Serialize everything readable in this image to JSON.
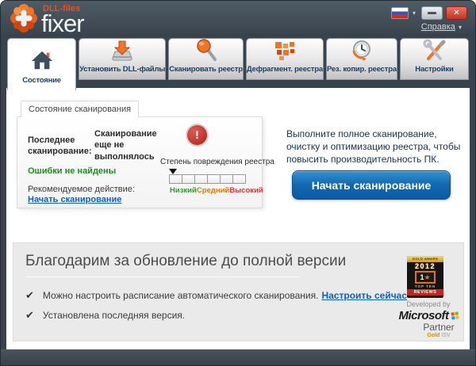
{
  "window": {
    "help_label": "Справка",
    "logo": {
      "brand_top": "DLL-files",
      "brand_main": "fixer"
    }
  },
  "icons": {
    "check": "✔",
    "caret_down": "▾",
    "close": "✕",
    "warning": "!",
    "star": "★"
  },
  "tabs": [
    {
      "label": "Состояние",
      "icon": "home-icon",
      "active": true
    },
    {
      "label": "Установить DLL-файлы",
      "icon": "install-dll-icon",
      "active": false
    },
    {
      "label": "Сканировать реестр",
      "icon": "scan-registry-icon",
      "active": false
    },
    {
      "label": "Дефрагмент. реестра",
      "icon": "defrag-registry-icon",
      "active": false
    },
    {
      "label": "Рез. копир. реестра",
      "icon": "backup-registry-icon",
      "active": false
    },
    {
      "label": "Настройки",
      "icon": "settings-icon",
      "active": false
    }
  ],
  "scan_status": {
    "tab_label": "Состояние сканирования",
    "last_scan_label": "Последнее сканирование:",
    "last_scan_value": "Сканирование еще не выполнялось",
    "errors_text": "Ошибки не найдены",
    "recommended_label": "Рекомендуемое действие:",
    "recommended_link": "Начать сканирование",
    "damage_label": "Степень повреждения реестра",
    "damage_levels": {
      "low": "Низкий",
      "medium": "Средний",
      "high": "Высокий"
    },
    "gauge_segments": 6,
    "gauge_marker_position": "low"
  },
  "main": {
    "description": "Выполните полное сканирование, очистку и оптимизацию реестра, чтобы повысить производительность ПК.",
    "start_button": "Начать сканирование"
  },
  "upgrade_panel": {
    "title": "Благодарим за обновление до полной версии",
    "items": [
      {
        "text": "Можно настроить расписание автоматического сканирования.",
        "link": "Настроить сейчас"
      },
      {
        "text": "Установлена последняя версия.",
        "link": ""
      }
    ],
    "award": {
      "ribbon": "GOLD AWARD",
      "year": "2012",
      "logo_digit": "1",
      "top_ten": "TOP TEN",
      "reviews": "REVIEWS"
    },
    "partner": {
      "developed_by": "Developed by",
      "brand": "Microsoft",
      "partner": "Partner",
      "gold": "Gold",
      "isv": "ISV"
    }
  },
  "colors": {
    "accent_orange": "#e8601c",
    "button_blue": "#1268b0",
    "success_green": "#1f8c1f",
    "warning_red": "#b02318",
    "header_dark": "#39434d"
  }
}
